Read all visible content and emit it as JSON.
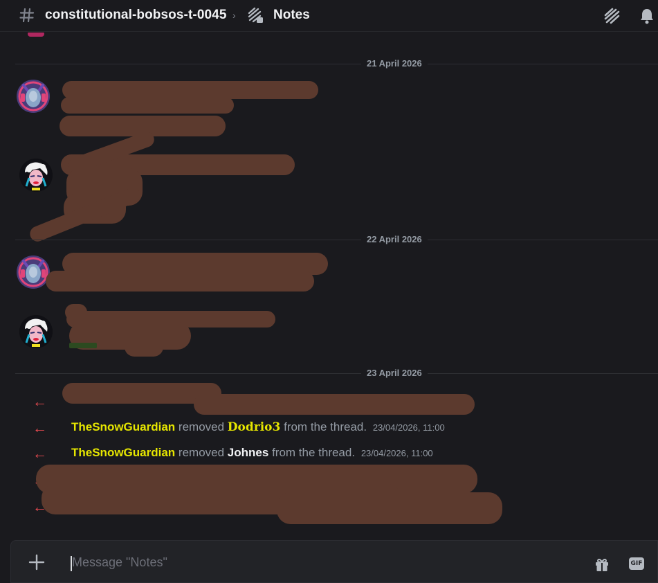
{
  "header": {
    "channel_name": "constitutional-bobsos-t-0045",
    "separator": "›",
    "thread_name": "Notes",
    "icons": [
      "hash-icon",
      "thread-icon",
      "threads-icon",
      "bell-icon"
    ]
  },
  "dividers": [
    "21 April 2026",
    "22 April 2026",
    "23 April 2026"
  ],
  "system_messages": [
    {
      "actor": "TheSnowGuardian",
      "verb": "removed",
      "target": "Dodrio3",
      "tail": "from the thread.",
      "timestamp": "23/04/2026, 11:00"
    },
    {
      "actor": "TheSnowGuardian",
      "verb": "removed",
      "target": "Johnes",
      "tail": "from the thread.",
      "timestamp": "23/04/2026, 11:00"
    }
  ],
  "composer": {
    "placeholder": "Message \"Notes\"",
    "gif_label": "GIF"
  },
  "colors": {
    "background": "#1a1a1e",
    "redaction": "#5c3a2e",
    "actor": "#e6e600",
    "arrow": "#e84a50"
  }
}
